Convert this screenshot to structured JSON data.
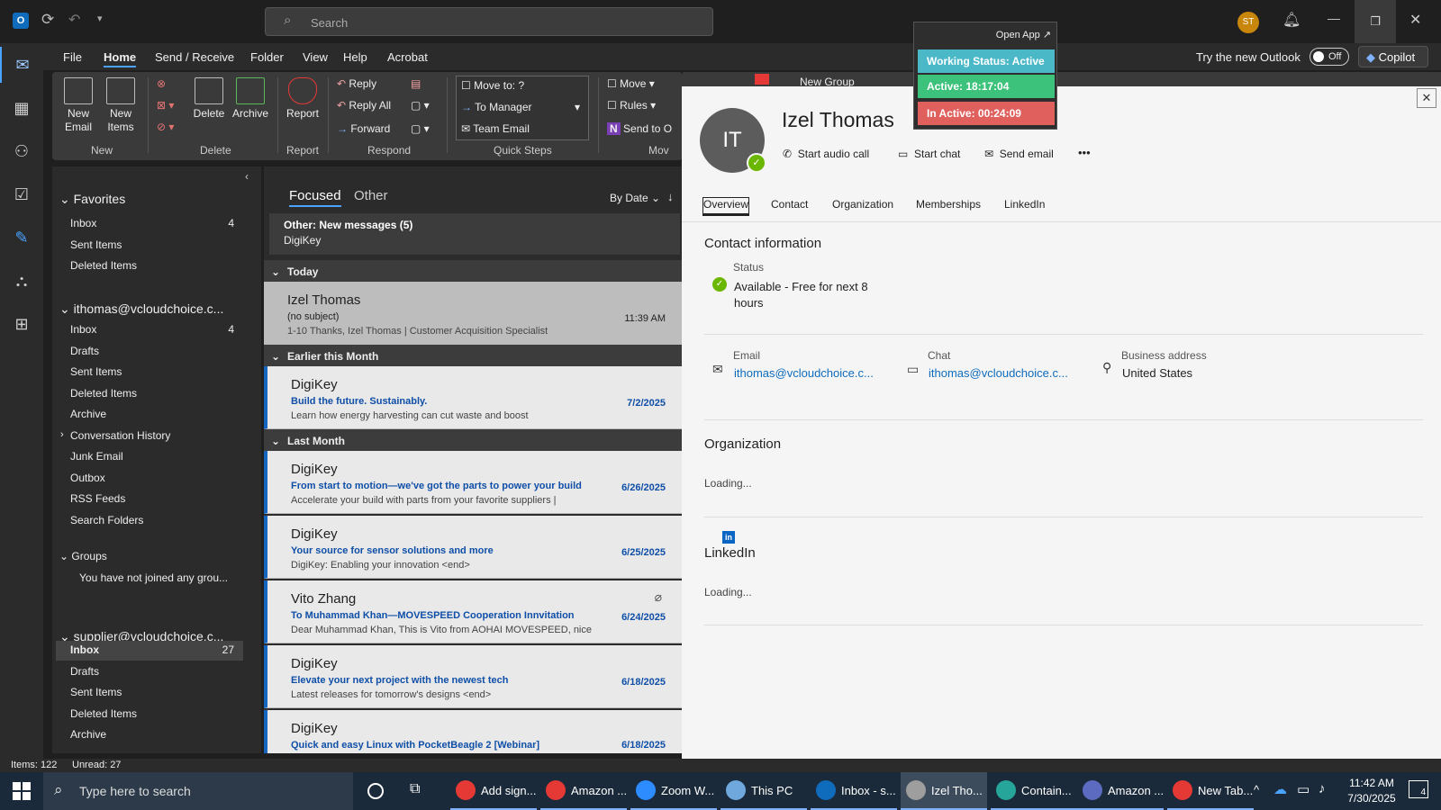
{
  "title_bar": {
    "search_placeholder": "Search",
    "avatar_initials": "ST"
  },
  "menu": {
    "items": [
      "File",
      "Home",
      "Send / Receive",
      "Folder",
      "View",
      "Help",
      "Acrobat"
    ],
    "active": "Home",
    "try_new_outlook": "Try the new Outlook",
    "toggle_state": "Off",
    "copilot": "Copilot"
  },
  "ribbon": {
    "new_email": "New Email",
    "new_items": "New Items",
    "group_new": "New",
    "delete": "Delete",
    "archive": "Archive",
    "group_delete": "Delete",
    "report": "Report",
    "group_report": "Report",
    "reply": "Reply",
    "reply_all": "Reply All",
    "forward": "Forward",
    "group_respond": "Respond",
    "move_to": "Move to: ?",
    "to_manager": "To Manager",
    "team_email": "Team Email",
    "group_quick_steps": "Quick Steps",
    "move": "Move",
    "rules": "Rules",
    "send_to": "Send to O",
    "group_move": "Mov",
    "new_group": "New Group"
  },
  "working_status": {
    "open_app": "Open App ↗",
    "status": "Working Status: Active",
    "active": "Active: 18:17:04",
    "inactive": "In Active: 00:24:09"
  },
  "folders": {
    "favorites_label": "Favorites",
    "favorites": [
      {
        "name": "Inbox",
        "count": "4"
      },
      {
        "name": "Sent Items",
        "count": ""
      },
      {
        "name": "Deleted Items",
        "count": ""
      }
    ],
    "account1_label": "ithomas@vcloudchoice.c...",
    "account1": [
      {
        "name": "Inbox",
        "count": "4"
      },
      {
        "name": "Drafts",
        "count": ""
      },
      {
        "name": "Sent Items",
        "count": ""
      },
      {
        "name": "Deleted Items",
        "count": ""
      },
      {
        "name": "Archive",
        "count": ""
      },
      {
        "name": "Conversation History",
        "count": ""
      },
      {
        "name": "Junk Email",
        "count": ""
      },
      {
        "name": "Outbox",
        "count": ""
      },
      {
        "name": "RSS Feeds",
        "count": ""
      },
      {
        "name": "Search Folders",
        "count": ""
      }
    ],
    "groups_label": "Groups",
    "groups_empty": "You have not joined any grou...",
    "account2_label": "supplier@vcloudchoice.c...",
    "account2": [
      {
        "name": "Inbox",
        "count": "27"
      },
      {
        "name": "Drafts",
        "count": ""
      },
      {
        "name": "Sent Items",
        "count": ""
      },
      {
        "name": "Deleted Items",
        "count": ""
      },
      {
        "name": "Archive",
        "count": ""
      }
    ]
  },
  "message_list": {
    "tab_focused": "Focused",
    "tab_other": "Other",
    "sort": "By Date",
    "other_banner_title": "Other: New messages (5)",
    "other_banner_sub": "DigiKey",
    "section_today": "Today",
    "section_earlier": "Earlier this Month",
    "section_last": "Last Month",
    "messages": [
      {
        "from": "Izel Thomas",
        "subject": "(no subject)",
        "preview": "1-10  Thanks,  Izel Thomas | Customer Acquisition Specialist",
        "date": "11:39 AM"
      },
      {
        "from": "DigiKey",
        "subject": "Build the future. Sustainably.",
        "preview": "Learn how energy harvesting can cut waste and boost",
        "date": "7/2/2025"
      },
      {
        "from": "DigiKey",
        "subject": "From start to motion—we've got the parts to power your build",
        "preview": "Accelerate your build with parts from your favorite suppliers |",
        "date": "6/26/2025"
      },
      {
        "from": "DigiKey",
        "subject": "Your source for sensor solutions and more",
        "preview": "DigiKey: Enabling your innovation <end>",
        "date": "6/25/2025"
      },
      {
        "from": "Vito Zhang",
        "subject": "To Muhammad Khan—MOVESPEED Cooperation Innvitation",
        "preview": "Dear Muhammad Khan,  This is Vito from AOHAI MOVESPEED, nice",
        "date": "6/24/2025"
      },
      {
        "from": "DigiKey",
        "subject": "Elevate your next project with the newest tech",
        "preview": "Latest releases for tomorrow's designs <end>",
        "date": "6/18/2025"
      },
      {
        "from": "DigiKey",
        "subject": "Quick and easy Linux with PocketBeagle 2 [Webinar]",
        "preview": "",
        "date": "6/18/2025"
      }
    ]
  },
  "contact": {
    "initials": "IT",
    "name": "Izel Thomas",
    "audio_call": "Start audio call",
    "chat": "Start chat",
    "email_action": "Send email",
    "more": "•••",
    "tabs": [
      "Overview",
      "Contact",
      "Organization",
      "Memberships",
      "LinkedIn"
    ],
    "contact_info_heading": "Contact information",
    "status_label": "Status",
    "status_value": "Available - Free for next 8 hours",
    "email_label": "Email",
    "email_value": "ithomas@vcloudchoice.c...",
    "chat_label": "Chat",
    "chat_value": "ithomas@vcloudchoice.c...",
    "address_label": "Business address",
    "address_value": "United States",
    "org_heading": "Organization",
    "org_loading": "Loading...",
    "linkedin_heading": "LinkedIn",
    "linkedin_loading": "Loading..."
  },
  "status_bar": {
    "items": "Items: 122",
    "unread": "Unread: 27"
  },
  "taskbar": {
    "search": "Type here to search",
    "apps": [
      {
        "label": "Add sign...",
        "color": "#e53935"
      },
      {
        "label": "Amazon ...",
        "color": "#e53935"
      },
      {
        "label": "Zoom W...",
        "color": "#2d8cff"
      },
      {
        "label": "This PC",
        "color": "#6fa8dc"
      },
      {
        "label": "Inbox - s...",
        "color": "#0f6cbd"
      },
      {
        "label": "Izel Tho...",
        "color": "#9e9e9e"
      },
      {
        "label": "Contain...",
        "color": "#26a69a"
      },
      {
        "label": "Amazon ...",
        "color": "#5c6bc0"
      },
      {
        "label": "New Tab...",
        "color": "#e53935"
      }
    ],
    "time": "11:42 AM",
    "date": "7/30/2025",
    "notif_count": "4"
  }
}
